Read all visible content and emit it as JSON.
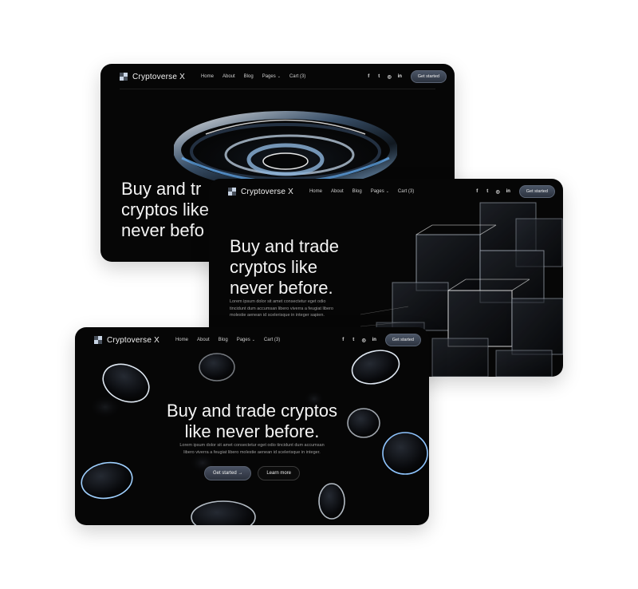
{
  "brand": {
    "name": "Cryptoverse X"
  },
  "nav": {
    "items": [
      {
        "label": "Home"
      },
      {
        "label": "About"
      },
      {
        "label": "Blog"
      },
      {
        "label": "Pages"
      },
      {
        "label": "Cart (3)"
      }
    ],
    "pages_chevron": "⌄",
    "social": [
      {
        "glyph": "f",
        "icon": "facebook-icon"
      },
      {
        "glyph": "t",
        "icon": "twitter-icon"
      },
      {
        "glyph": "◎",
        "icon": "instagram-icon"
      },
      {
        "glyph": "in",
        "icon": "linkedin-icon"
      }
    ],
    "cta": "Get started"
  },
  "cards": {
    "a": {
      "hero_lines": [
        "Buy and tr",
        "cryptos like",
        "never befo"
      ]
    },
    "b": {
      "hero_lines": [
        "Buy and trade",
        "cryptos like",
        "never before."
      ],
      "body_lines": [
        "Lorem ipsum dolor sit amet consectetur eget odio",
        "tincidunt dum accumsan libero viverra a feugiat libero",
        "molestie aenean id scelerisque in integer sapien."
      ]
    },
    "c": {
      "hero_lines": [
        "Buy and trade cryptos",
        "like never before."
      ],
      "body_lines": [
        "Lorem ipsum dolor sit amet consectetur eget odio tincidunt dum accumsan",
        "libero viverra a feugiat libero molestie aenean id scelerisque in integer."
      ],
      "primary_button": "Get started →",
      "secondary_button": "Learn more"
    }
  },
  "colors": {
    "card_bg": "#060606",
    "accent": "#4a5263",
    "text": "#f4f4f4"
  }
}
